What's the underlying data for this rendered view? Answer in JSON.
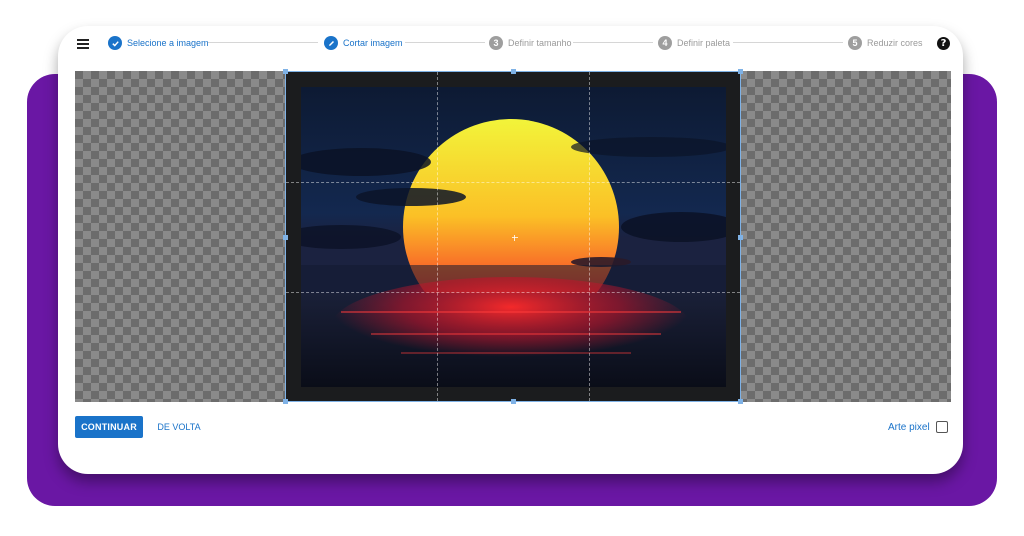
{
  "stepper": {
    "steps": [
      {
        "number": "1",
        "label": "Selecione a imagem",
        "status": "done",
        "icon": "check-icon"
      },
      {
        "number": "2",
        "label": "Cortar imagem",
        "status": "current",
        "icon": "pencil-icon"
      },
      {
        "number": "3",
        "label": "Definir tamanho",
        "status": "todo"
      },
      {
        "number": "4",
        "label": "Definir paleta",
        "status": "todo"
      },
      {
        "number": "5",
        "label": "Reduzir cores",
        "status": "todo"
      }
    ]
  },
  "header": {
    "menu_icon": "menu-icon",
    "help_icon": "help-icon",
    "help_glyph": "?"
  },
  "colors": {
    "accent": "#1a73c9",
    "frame": "#6a17a4",
    "inactive": "#9e9e9e"
  },
  "actions": {
    "continue_label": "CONTINUAR",
    "back_label": "DE VOLTA",
    "pixel_art_label": "Arte pixel",
    "pixel_art_checked": false
  }
}
